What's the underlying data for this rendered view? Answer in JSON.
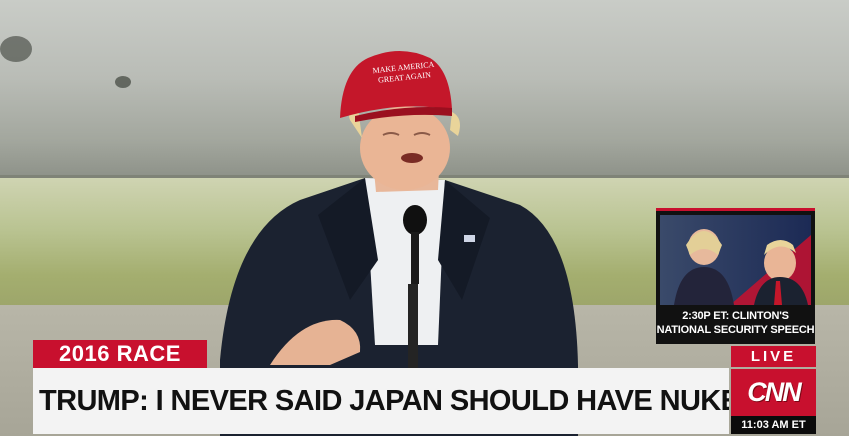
{
  "lower_third": {
    "tag": "2016 RACE",
    "headline": "TRUMP: I NEVER SAID JAPAN SHOULD HAVE NUKES (HE DID)"
  },
  "inset": {
    "caption_line1": "2:30P ET: CLINTON'S",
    "caption_line2": "NATIONAL SECURITY SPEECH"
  },
  "bug": {
    "live": "LIVE",
    "network": "CNN",
    "time": "11:03 AM ET"
  },
  "hat": {
    "line1": "MAKE AMERICA",
    "line2": "GREAT AGAIN"
  },
  "colors": {
    "cnn_red": "#c8102e",
    "headline_bg": "#f3f3f3",
    "suit": "#1b2230",
    "hat": "#c4172a"
  }
}
